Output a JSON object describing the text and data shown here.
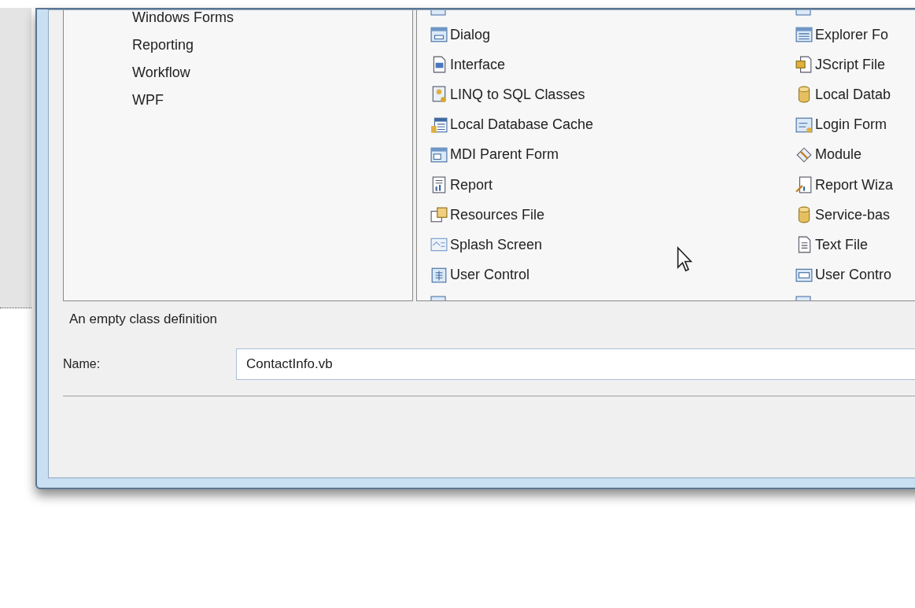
{
  "categories": [
    {
      "label": "Windows Forms",
      "selected": false
    },
    {
      "label": "Reporting",
      "selected": false
    },
    {
      "label": "Workflow",
      "selected": false
    },
    {
      "label": "WPF",
      "selected": false
    }
  ],
  "templates": [
    {
      "label": "Dialog",
      "selected": false
    },
    {
      "label": "Explorer Fo",
      "selected": false
    },
    {
      "label": "Interface",
      "selected": false
    },
    {
      "label": "JScript File",
      "selected": false
    },
    {
      "label": "LINQ to SQL Classes",
      "selected": false
    },
    {
      "label": "Local Datab",
      "selected": false
    },
    {
      "label": "Local Database Cache",
      "selected": false
    },
    {
      "label": "Login Form",
      "selected": false
    },
    {
      "label": "MDI Parent Form",
      "selected": false
    },
    {
      "label": "Module",
      "selected": false
    },
    {
      "label": "Report",
      "selected": false
    },
    {
      "label": "Report Wiza",
      "selected": false
    },
    {
      "label": "Resources File",
      "selected": false
    },
    {
      "label": "Service-bas",
      "selected": false
    },
    {
      "label": "Splash Screen",
      "selected": false
    },
    {
      "label": "Text File",
      "selected": false
    },
    {
      "label": "User Control",
      "selected": false
    },
    {
      "label": "User Contro",
      "selected": false
    }
  ],
  "description": "An empty class definition",
  "name_field": {
    "label": "Name:",
    "value": "ContactInfo.vb"
  }
}
